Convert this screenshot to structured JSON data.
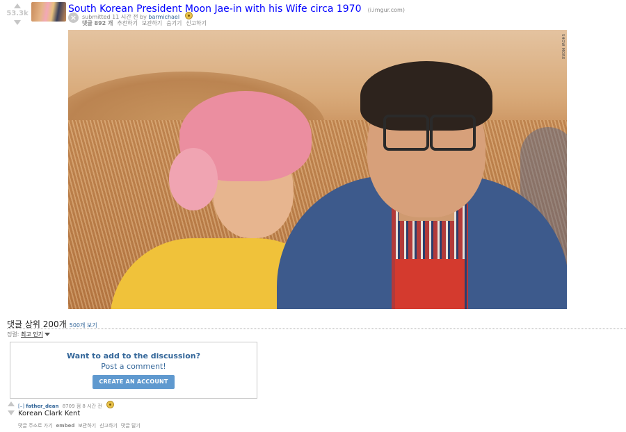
{
  "post": {
    "score": "53.3k",
    "title": "South Korean President Moon Jae-in with his Wife circa 1970",
    "domain": "(i.imgur.com)",
    "submitted_prefix": "submitted 11 시간 전 by",
    "author": "barmichael",
    "buttons": {
      "comments": "댓글 892 개",
      "share": "추천하기",
      "save": "보관하기",
      "hide": "숨기기",
      "report": "신고하기"
    },
    "photo_watermark": "SHOW MORE"
  },
  "comments_section": {
    "header": "댓글 상위 200개",
    "show_more": "500개 보기",
    "sort_label": "정렬:",
    "sort_value": "최고 인기"
  },
  "discussion_box": {
    "title": "Want to add to the discussion?",
    "subtitle": "Post a comment!",
    "button": "CREATE AN ACCOUNT"
  },
  "comment": {
    "toggle": "[–]",
    "author": "father_dean",
    "meta": "8709 점 8 시간 전",
    "body": "Korean Clark Kent",
    "buttons": {
      "permalink": "댓글 주소로 가기",
      "embed": "embed",
      "save": "보관하기",
      "report": "신고하기",
      "reply": "댓글 달기"
    }
  },
  "colors": {
    "link": "#0000ff",
    "meta_link": "#336699",
    "button": "#5f99cf",
    "vote_arrow": "#c6c6c6"
  }
}
